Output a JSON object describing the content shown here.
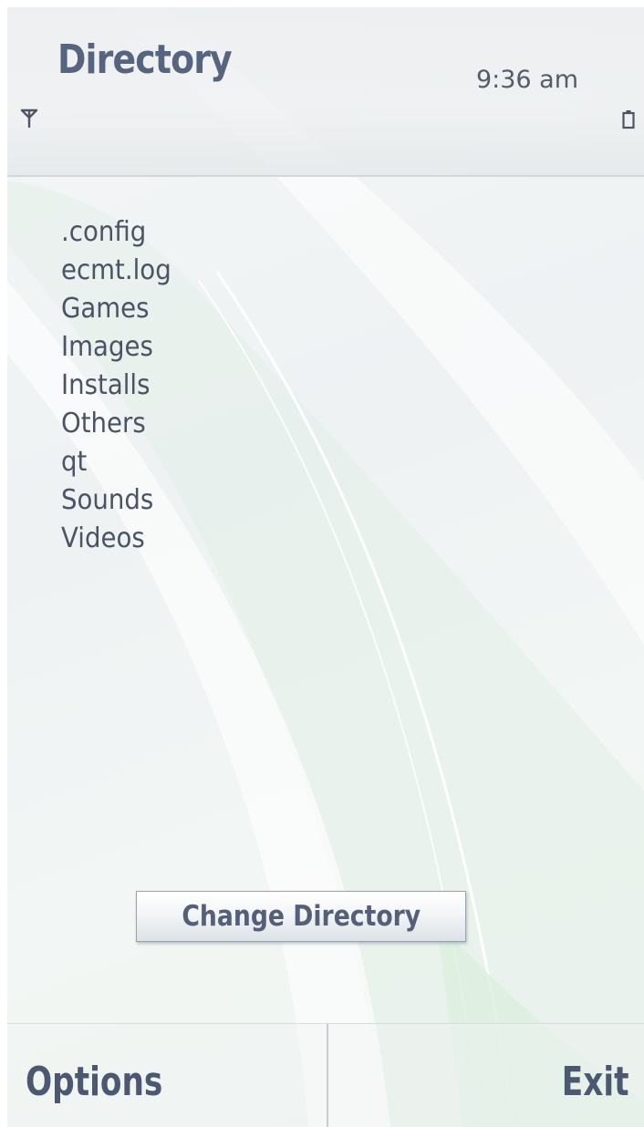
{
  "status_bar": {
    "title": "Directory",
    "clock": "9:36 am",
    "signal_icon": "antenna-signal-icon",
    "battery_icon": "battery-icon"
  },
  "file_list": {
    "items": [
      ".config",
      "ecmt.log",
      "Games",
      "Images",
      "Installs",
      "Others",
      "qt",
      "Sounds",
      "Videos"
    ]
  },
  "change_directory_button": {
    "label": "Change Directory"
  },
  "softkeys": {
    "left_label": "Options",
    "right_label": "Exit"
  },
  "colors": {
    "title_text": "#576480",
    "list_text": "#4b5364",
    "softkey_text": "#4c5872",
    "swoosh_green": "#cfe6d6"
  }
}
